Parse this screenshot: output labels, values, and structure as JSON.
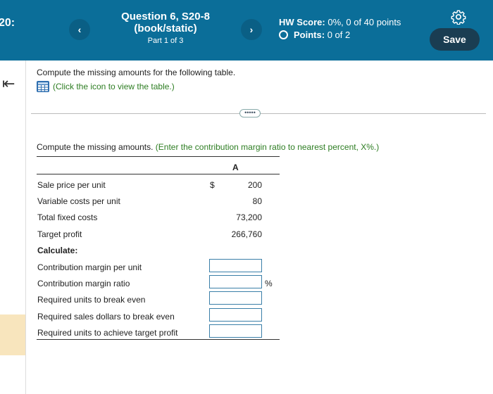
{
  "header": {
    "left_number": "20:",
    "prev_icon": "chevron-left",
    "next_icon": "chevron-right",
    "question_title_line1": "Question 6, S20-8",
    "question_title_line2": "(book/static)",
    "part": "Part 1 of 3",
    "hw_score_label": "HW Score:",
    "hw_score_value": "0%, 0 of 40 points",
    "points_label": "Points:",
    "points_value": "0 of 2",
    "settings_icon": "gear-icon",
    "save_label": "Save"
  },
  "rail": {
    "collapse_icon": "collapse-left-icon"
  },
  "content": {
    "instruction": "Compute the missing amounts for the following table.",
    "view_table_link": "(Click the icon to view the table.)",
    "more_button": "•••••",
    "prompt": "Compute the missing amounts.",
    "prompt_hint": "(Enter the contribution margin ratio to nearest percent, X%.)"
  },
  "table": {
    "column_header": "A",
    "rows": [
      {
        "label": "Sale price per unit",
        "currency": "$",
        "value": "200"
      },
      {
        "label": "Variable costs per unit",
        "currency": "",
        "value": "80"
      },
      {
        "label": "Total fixed costs",
        "currency": "",
        "value": "73,200"
      },
      {
        "label": "Target profit",
        "currency": "",
        "value": "266,760"
      }
    ],
    "calculate_label": "Calculate:",
    "calc_rows": [
      {
        "label": "Contribution margin per unit",
        "input_value": "",
        "suffix": ""
      },
      {
        "label": "Contribution margin ratio",
        "input_value": "",
        "suffix": "%"
      },
      {
        "label": "Required units to break even",
        "input_value": "",
        "suffix": ""
      },
      {
        "label": "Required sales dollars to break even",
        "input_value": "",
        "suffix": ""
      },
      {
        "label": "Required units to achieve target profit",
        "input_value": "",
        "suffix": ""
      }
    ]
  },
  "colors": {
    "header_bg": "#0b6e99",
    "save_bg": "#1a3d52",
    "hint_green": "#2d7d22",
    "input_border": "#3a7fa8"
  }
}
